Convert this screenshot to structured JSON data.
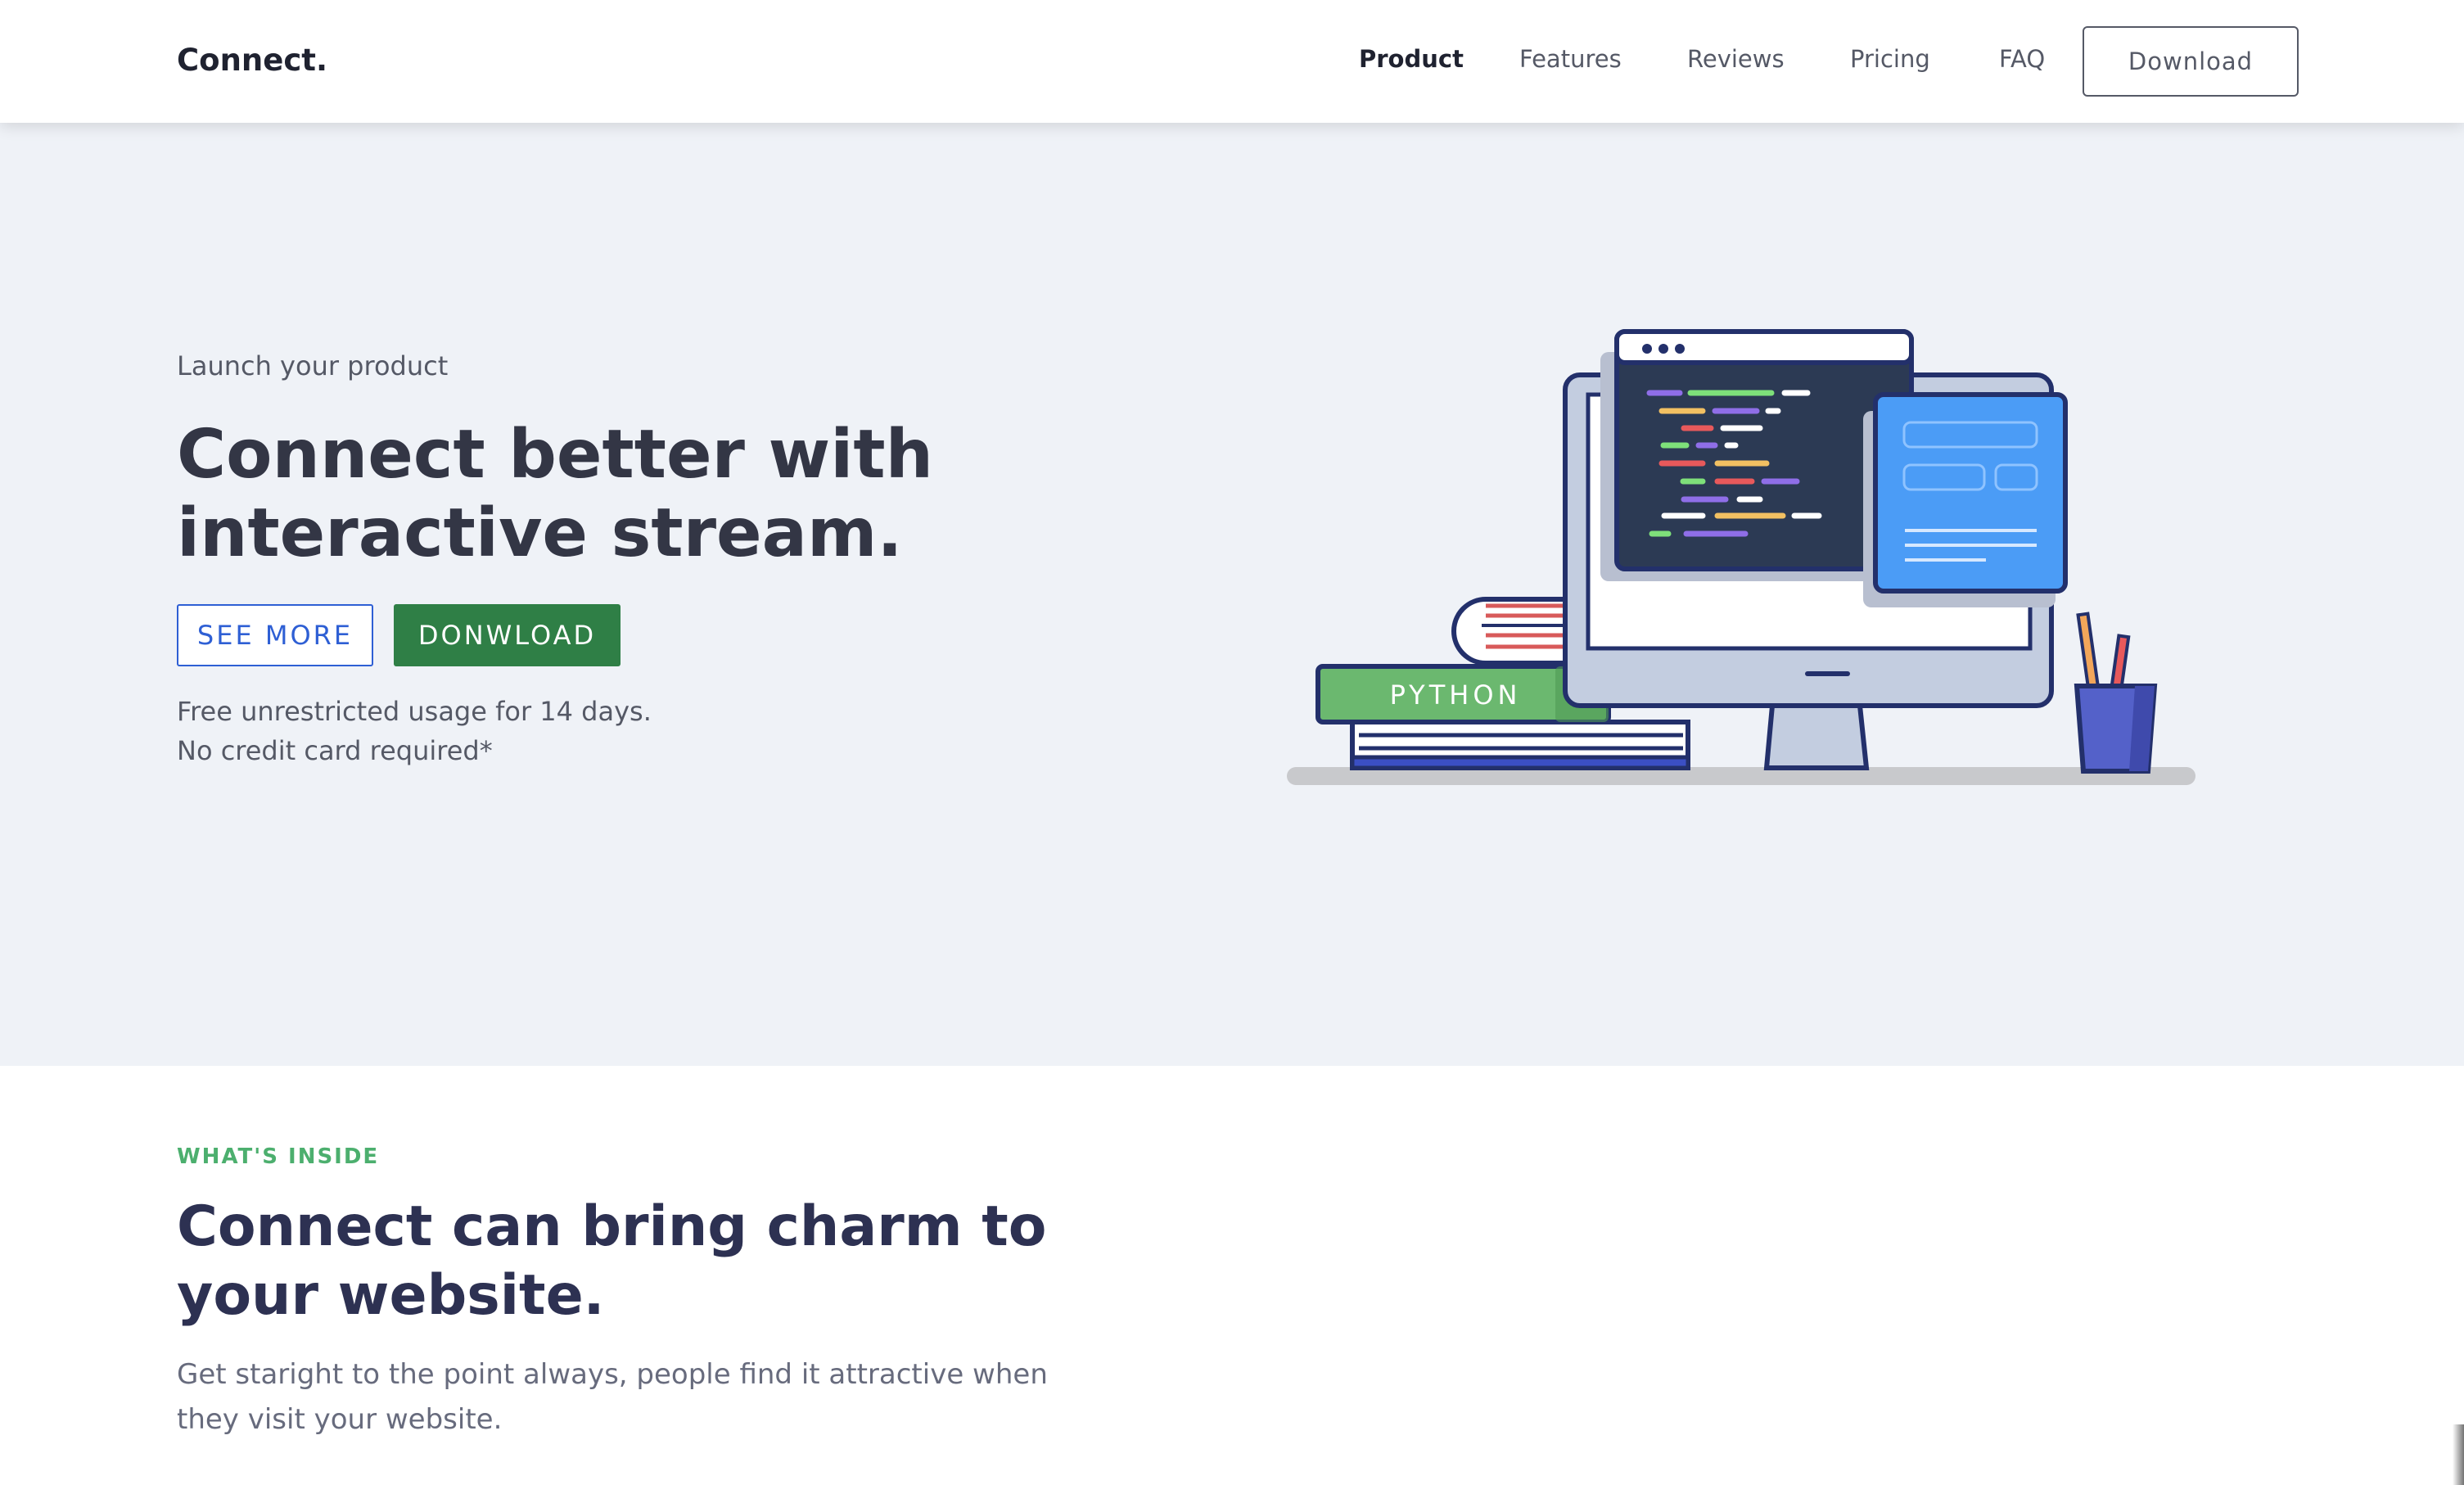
{
  "navbar": {
    "brand": "Connect.",
    "links": [
      "Product",
      "Features",
      "Reviews",
      "Pricing",
      "FAQ"
    ],
    "active_link": "Product",
    "download_label": "Download"
  },
  "hero": {
    "eyebrow": "Launch your product",
    "title": "Connect better with interactive stream.",
    "see_more_label": "SEE MORE",
    "download_label": "DONWLOAD",
    "note_line1": "Free unrestricted usage for 14 days.",
    "note_line2": "No credit card required*",
    "illustration": {
      "book_label": "PYTHON",
      "icon": "desktop-coding-illustration"
    }
  },
  "inside": {
    "eyebrow": "WHAT'S INSIDE",
    "title": "Connect can bring charm to your website.",
    "description": "Get staright to the point always, people find it attractive when they visit your website."
  },
  "colors": {
    "accent_blue": "#2e5fd4",
    "accent_green": "#2f7f46",
    "eyebrow_green": "#4caf6e",
    "hero_background": "#eff2f7"
  }
}
